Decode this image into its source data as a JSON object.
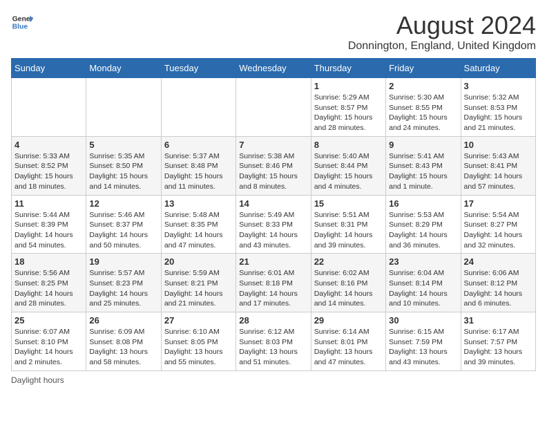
{
  "header": {
    "logo_line1": "General",
    "logo_line2": "Blue",
    "month_title": "August 2024",
    "location": "Donnington, England, United Kingdom"
  },
  "weekdays": [
    "Sunday",
    "Monday",
    "Tuesday",
    "Wednesday",
    "Thursday",
    "Friday",
    "Saturday"
  ],
  "weeks": [
    [
      {
        "day": "",
        "sunrise": "",
        "sunset": "",
        "daylight": ""
      },
      {
        "day": "",
        "sunrise": "",
        "sunset": "",
        "daylight": ""
      },
      {
        "day": "",
        "sunrise": "",
        "sunset": "",
        "daylight": ""
      },
      {
        "day": "",
        "sunrise": "",
        "sunset": "",
        "daylight": ""
      },
      {
        "day": "1",
        "sunrise": "Sunrise: 5:29 AM",
        "sunset": "Sunset: 8:57 PM",
        "daylight": "Daylight: 15 hours and 28 minutes."
      },
      {
        "day": "2",
        "sunrise": "Sunrise: 5:30 AM",
        "sunset": "Sunset: 8:55 PM",
        "daylight": "Daylight: 15 hours and 24 minutes."
      },
      {
        "day": "3",
        "sunrise": "Sunrise: 5:32 AM",
        "sunset": "Sunset: 8:53 PM",
        "daylight": "Daylight: 15 hours and 21 minutes."
      }
    ],
    [
      {
        "day": "4",
        "sunrise": "Sunrise: 5:33 AM",
        "sunset": "Sunset: 8:52 PM",
        "daylight": "Daylight: 15 hours and 18 minutes."
      },
      {
        "day": "5",
        "sunrise": "Sunrise: 5:35 AM",
        "sunset": "Sunset: 8:50 PM",
        "daylight": "Daylight: 15 hours and 14 minutes."
      },
      {
        "day": "6",
        "sunrise": "Sunrise: 5:37 AM",
        "sunset": "Sunset: 8:48 PM",
        "daylight": "Daylight: 15 hours and 11 minutes."
      },
      {
        "day": "7",
        "sunrise": "Sunrise: 5:38 AM",
        "sunset": "Sunset: 8:46 PM",
        "daylight": "Daylight: 15 hours and 8 minutes."
      },
      {
        "day": "8",
        "sunrise": "Sunrise: 5:40 AM",
        "sunset": "Sunset: 8:44 PM",
        "daylight": "Daylight: 15 hours and 4 minutes."
      },
      {
        "day": "9",
        "sunrise": "Sunrise: 5:41 AM",
        "sunset": "Sunset: 8:43 PM",
        "daylight": "Daylight: 15 hours and 1 minute."
      },
      {
        "day": "10",
        "sunrise": "Sunrise: 5:43 AM",
        "sunset": "Sunset: 8:41 PM",
        "daylight": "Daylight: 14 hours and 57 minutes."
      }
    ],
    [
      {
        "day": "11",
        "sunrise": "Sunrise: 5:44 AM",
        "sunset": "Sunset: 8:39 PM",
        "daylight": "Daylight: 14 hours and 54 minutes."
      },
      {
        "day": "12",
        "sunrise": "Sunrise: 5:46 AM",
        "sunset": "Sunset: 8:37 PM",
        "daylight": "Daylight: 14 hours and 50 minutes."
      },
      {
        "day": "13",
        "sunrise": "Sunrise: 5:48 AM",
        "sunset": "Sunset: 8:35 PM",
        "daylight": "Daylight: 14 hours and 47 minutes."
      },
      {
        "day": "14",
        "sunrise": "Sunrise: 5:49 AM",
        "sunset": "Sunset: 8:33 PM",
        "daylight": "Daylight: 14 hours and 43 minutes."
      },
      {
        "day": "15",
        "sunrise": "Sunrise: 5:51 AM",
        "sunset": "Sunset: 8:31 PM",
        "daylight": "Daylight: 14 hours and 39 minutes."
      },
      {
        "day": "16",
        "sunrise": "Sunrise: 5:53 AM",
        "sunset": "Sunset: 8:29 PM",
        "daylight": "Daylight: 14 hours and 36 minutes."
      },
      {
        "day": "17",
        "sunrise": "Sunrise: 5:54 AM",
        "sunset": "Sunset: 8:27 PM",
        "daylight": "Daylight: 14 hours and 32 minutes."
      }
    ],
    [
      {
        "day": "18",
        "sunrise": "Sunrise: 5:56 AM",
        "sunset": "Sunset: 8:25 PM",
        "daylight": "Daylight: 14 hours and 28 minutes."
      },
      {
        "day": "19",
        "sunrise": "Sunrise: 5:57 AM",
        "sunset": "Sunset: 8:23 PM",
        "daylight": "Daylight: 14 hours and 25 minutes."
      },
      {
        "day": "20",
        "sunrise": "Sunrise: 5:59 AM",
        "sunset": "Sunset: 8:21 PM",
        "daylight": "Daylight: 14 hours and 21 minutes."
      },
      {
        "day": "21",
        "sunrise": "Sunrise: 6:01 AM",
        "sunset": "Sunset: 8:18 PM",
        "daylight": "Daylight: 14 hours and 17 minutes."
      },
      {
        "day": "22",
        "sunrise": "Sunrise: 6:02 AM",
        "sunset": "Sunset: 8:16 PM",
        "daylight": "Daylight: 14 hours and 14 minutes."
      },
      {
        "day": "23",
        "sunrise": "Sunrise: 6:04 AM",
        "sunset": "Sunset: 8:14 PM",
        "daylight": "Daylight: 14 hours and 10 minutes."
      },
      {
        "day": "24",
        "sunrise": "Sunrise: 6:06 AM",
        "sunset": "Sunset: 8:12 PM",
        "daylight": "Daylight: 14 hours and 6 minutes."
      }
    ],
    [
      {
        "day": "25",
        "sunrise": "Sunrise: 6:07 AM",
        "sunset": "Sunset: 8:10 PM",
        "daylight": "Daylight: 14 hours and 2 minutes."
      },
      {
        "day": "26",
        "sunrise": "Sunrise: 6:09 AM",
        "sunset": "Sunset: 8:08 PM",
        "daylight": "Daylight: 13 hours and 58 minutes."
      },
      {
        "day": "27",
        "sunrise": "Sunrise: 6:10 AM",
        "sunset": "Sunset: 8:05 PM",
        "daylight": "Daylight: 13 hours and 55 minutes."
      },
      {
        "day": "28",
        "sunrise": "Sunrise: 6:12 AM",
        "sunset": "Sunset: 8:03 PM",
        "daylight": "Daylight: 13 hours and 51 minutes."
      },
      {
        "day": "29",
        "sunrise": "Sunrise: 6:14 AM",
        "sunset": "Sunset: 8:01 PM",
        "daylight": "Daylight: 13 hours and 47 minutes."
      },
      {
        "day": "30",
        "sunrise": "Sunrise: 6:15 AM",
        "sunset": "Sunset: 7:59 PM",
        "daylight": "Daylight: 13 hours and 43 minutes."
      },
      {
        "day": "31",
        "sunrise": "Sunrise: 6:17 AM",
        "sunset": "Sunset: 7:57 PM",
        "daylight": "Daylight: 13 hours and 39 minutes."
      }
    ]
  ],
  "footer": {
    "note": "Daylight hours"
  }
}
